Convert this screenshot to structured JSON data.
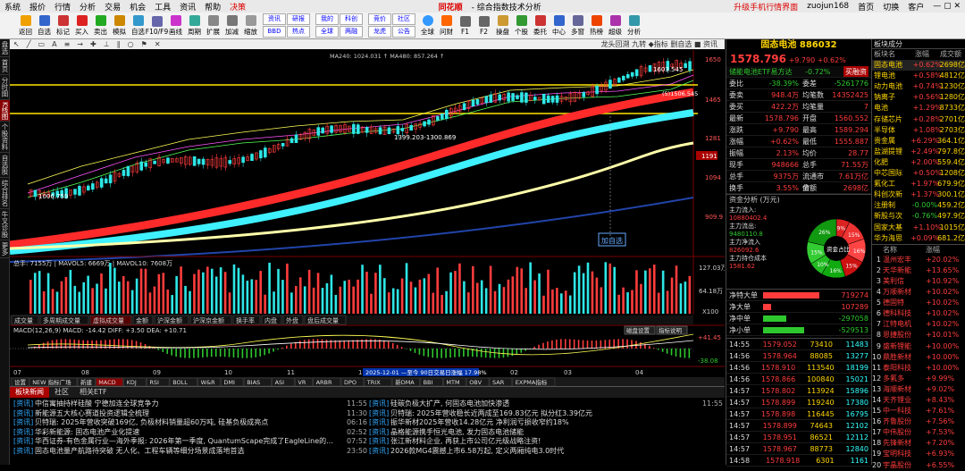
{
  "menu": [
    "系统",
    "报价",
    "行情",
    "分析",
    "交易",
    "机会",
    "工具",
    "资讯",
    "帮助",
    "决策"
  ],
  "app_logo": "同花顺",
  "app_sub": "- 综合指数技术分析",
  "user_links": [
    "升级手机行情界面",
    "zuojun168",
    "首页",
    "切换",
    "客户"
  ],
  "toolbar": [
    "返回",
    "自选",
    "标记",
    "买入",
    "卖出",
    "模拟",
    "自选",
    "F10/F9",
    "画线",
    "周期",
    "扩展",
    "加减",
    "缩放"
  ],
  "toolbar2": [
    "资讯",
    "研报",
    "BBD",
    "热点",
    "我的",
    "科创",
    "全球",
    "两融",
    "竞价",
    "社区",
    "龙虎",
    "公告"
  ],
  "toolbar3": [
    "全球",
    "问财",
    "F1",
    "F2",
    "操盘",
    "个股",
    "委托",
    "中心",
    "多窗",
    "热榜",
    "超级",
    "分析"
  ],
  "chart_top": "龙头回溯 九转 ◆指标 删自选 ■ 资讯",
  "indicator_line": "MA240: 1024.031 ↑ MA480: 857.264 ↑",
  "price_labels": [
    "1605.545",
    "1650",
    "1465",
    "1281",
    "1191",
    "1094",
    "909.9"
  ],
  "annotations": [
    "1603.545",
    "1399.203-1300.869",
    "(5)1506.545",
    "1006.759",
    "加自选"
  ],
  "vol_label": "总手: 7155万 | MAVOL5: 6669万 | MAVOL10: 7608万",
  "vol_axis": [
    "127.03万",
    "64.18万",
    "X100"
  ],
  "subtabs": [
    "成交量",
    "多周期成交量",
    "虚拟成交量",
    "金额",
    "沪深金额",
    "沪深京金额",
    "换手率",
    "内盘",
    "外盘",
    "盘后成交量"
  ],
  "macd_label": "MACD(12,26,9)  MACD: -14.42  DIFF: +3.50  DEA: +10.71",
  "macd_axis": [
    "+41.45",
    "-38.08"
  ],
  "macd_btns": [
    "磁盘设置",
    "指标说明"
  ],
  "dates": [
    "07",
    "08",
    "09",
    "10",
    "11",
    "12",
    "01",
    "02",
    "03",
    "04"
  ],
  "date_tip": "2025-12-01 —至今 90日交易日涨幅 17.98%",
  "ind_tabs": [
    "设置",
    "NEW 指标广场",
    "新建",
    "MACD",
    "KDJ",
    "RSI",
    "BOLL",
    "W&R",
    "DMI",
    "BIAS",
    "ASI",
    "VR",
    "ARBR",
    "DPO",
    "TRIX",
    "新DMA",
    "BBI",
    "MTM",
    "OBV",
    "SAR",
    "EXPMA指标"
  ],
  "news_tabs": [
    "板块新闻",
    "社区",
    "相关ETF"
  ],
  "news_left": [
    {
      "tag": "资讯",
      "text": "中信寓抽持样硅酸 宁德加连全球竞争力",
      "time": "11:55"
    },
    {
      "tag": "资讯",
      "text": "新能源五大核心赛道投资逻辑全梳理",
      "time": "11:30"
    },
    {
      "tag": "资讯",
      "text": "贝特瑞: 2025年营收突破169亿, 负极材料销量超60万吨, 硅基负极成亮点",
      "time": "06:16"
    },
    {
      "tag": "资讯",
      "text": "华彩新能源: 固态电池产业化提速",
      "time": "02:52"
    },
    {
      "tag": "资讯",
      "text": "华西证券-有色金属行业—海外季报: 2026年第一季度, QuantumScape完成了EagleLine的...",
      "time": "07:52"
    },
    {
      "tag": "资讯",
      "text": "固态电池量产航路待突破 无人化、工程车辆等细分场景成落地首选",
      "time": "23:50"
    }
  ],
  "news_right": [
    {
      "tag": "资讯",
      "text": "硅碳负极大扩产, 何固态电池加快渗透",
      "time": "11:55"
    },
    {
      "tag": "资讯",
      "text": "贝特瑞: 2025年营收稳长近两成至169.83亿元 拟分红3.39亿元",
      "time": ""
    },
    {
      "tag": "资讯",
      "text": "振华新材2025年营收14.28亿元 净利润亏损收窄约18%",
      "time": ""
    },
    {
      "tag": "资讯",
      "text": "晶格能源携手恒光电池, 发力固态电池储能",
      "time": ""
    },
    {
      "tag": "资讯",
      "text": "张江新材料企业, 再获上市公司亿元级战略注资!",
      "time": ""
    },
    {
      "tag": "资讯",
      "text": "2026款MG4震撼上市6.58万起, 定义两厢纯电3.0时代",
      "time": ""
    }
  ],
  "quote": {
    "name": "固态电池",
    "code": "886032",
    "price": "1578.796",
    "change": "+9.790",
    "pct": "+0.62%",
    "etf": "储能电池ETF易方达",
    "etf_pct": "-0.72%",
    "etf_btn": "买融资",
    "rows": [
      [
        "委比",
        "-38.39%",
        "委差",
        "-5261776"
      ],
      [
        "委卖",
        "948.4万",
        "均笔数",
        "14352425"
      ],
      [
        "委买",
        "422.2万",
        "均笔量",
        "7"
      ],
      [
        "最新",
        "1578.796",
        "开盘",
        "1560.552"
      ],
      [
        "涨跌",
        "+9.790",
        "最高",
        "1589.294"
      ],
      [
        "涨幅",
        "+0.62%",
        "最低",
        "1555.887"
      ],
      [
        "振幅",
        "2.13%",
        "均价",
        "28.77"
      ],
      [
        "现手",
        "948666",
        "总手",
        "71.55万"
      ],
      [
        "总手",
        "9375万",
        "流通市值",
        "7.61万亿"
      ],
      [
        "换手",
        "3.55%",
        "金额",
        "2698亿"
      ]
    ],
    "fund_title": "资金分析 (万元)",
    "fund_labels": [
      "主力流入:",
      "主力流出:",
      "主力净流入",
      "主力持仓成本"
    ],
    "fund_vals": [
      "10880402.4",
      "9480110.8",
      "826092.6",
      "1581.62"
    ],
    "pie": [
      "9%",
      "15%",
      "16%",
      "15%",
      "16%",
      "10%",
      "15%",
      "26%"
    ],
    "pie_center": "资金占比",
    "flows": [
      {
        "label": "净特大单",
        "value": "719274"
      },
      {
        "label": "净大单",
        "value": "107289"
      },
      {
        "label": "净中单",
        "value": "-297058"
      },
      {
        "label": "净小单",
        "value": "-529513"
      }
    ],
    "ticks": [
      [
        "14:55",
        "1579.052",
        "73410",
        "11483"
      ],
      [
        "14:56",
        "1578.964",
        "88085",
        "13277"
      ],
      [
        "14:56",
        "1578.910",
        "113540",
        "18199"
      ],
      [
        "14:56",
        "1578.866",
        "100840",
        "15021"
      ],
      [
        "14:57",
        "1578.802",
        "113924",
        "15896"
      ],
      [
        "14:57",
        "1578.899",
        "119240",
        "17380"
      ],
      [
        "14:57",
        "1578.898",
        "116445",
        "16795"
      ],
      [
        "14:57",
        "1578.899",
        "74643",
        "12102"
      ],
      [
        "14:57",
        "1578.951",
        "86521",
        "12112"
      ],
      [
        "14:57",
        "1578.967",
        "88773",
        "12840"
      ],
      [
        "14:58",
        "1578.918",
        "6301",
        "1161"
      ]
    ]
  },
  "watch": {
    "title": "板块成分",
    "header": [
      "板块名",
      "涨幅",
      "成交额"
    ],
    "top": [
      [
        "固态电池",
        "+0.62%",
        "2698亿"
      ],
      [
        "锂电池",
        "+0.58%",
        "4812亿"
      ],
      [
        "动力电池",
        "+0.74%",
        "1230亿"
      ],
      [
        "钠离子",
        "+0.56%",
        "1280亿"
      ],
      [
        "电池",
        "+1.29%",
        "8733亿"
      ],
      [
        "存储芯片",
        "+0.28%",
        "2701亿"
      ],
      [
        "半导体",
        "+1.08%",
        "2703亿"
      ],
      [
        "贵金属",
        "+6.29%",
        "364.1亿"
      ],
      [
        "盐湖提锂",
        "+2.49%",
        "797.8亿"
      ],
      [
        "化肥",
        "+2.00%",
        "559.4亿"
      ],
      [
        "中芯国际",
        "+0.50%",
        "1208亿"
      ],
      [
        "氟化工",
        "+1.97%",
        "679.9亿"
      ],
      [
        "科创次新",
        "+1.37%",
        "300.1亿"
      ],
      [
        "注册制",
        "-0.00%",
        "459.2亿"
      ],
      [
        "新股与次",
        "-0.76%",
        "497.9亿"
      ],
      [
        "国家大基",
        "+1.10%",
        "1015亿"
      ],
      [
        "华为海思",
        "+0.09%",
        "681.2亿"
      ]
    ],
    "rank_header": [
      "名称",
      "涨幅"
    ],
    "rank": [
      [
        "1",
        "温州宏丰",
        "+20.02%"
      ],
      [
        "2",
        "天华新能",
        "+13.65%"
      ],
      [
        "3",
        "美利信",
        "+10.92%"
      ],
      [
        "4",
        "万顺新材",
        "+10.02%"
      ],
      [
        "5",
        "德固特",
        "+10.02%"
      ],
      [
        "6",
        "德科科技",
        "+10.02%"
      ],
      [
        "7",
        "江特电机",
        "+10.02%"
      ],
      [
        "8",
        "恩捷股份",
        "+10.01%"
      ],
      [
        "9",
        "盛新锂能",
        "+10.00%"
      ],
      [
        "10",
        "鼎胜新材",
        "+10.00%"
      ],
      [
        "11",
        "泰阳科技",
        "+10.00%"
      ],
      [
        "12",
        "多氟多",
        "+9.99%"
      ],
      [
        "13",
        "海顺新材",
        "+9.02%"
      ],
      [
        "14",
        "天齐锂业",
        "+8.43%"
      ],
      [
        "15",
        "中一科技",
        "+7.61%"
      ],
      [
        "16",
        "齐鲁股份",
        "+7.56%"
      ],
      [
        "17",
        "中伟股份",
        "+7.53%"
      ],
      [
        "18",
        "先锋新材",
        "+7.20%"
      ],
      [
        "19",
        "宝明科技",
        "+6.93%"
      ],
      [
        "20",
        "宇晶股份",
        "+6.55%"
      ]
    ]
  }
}
